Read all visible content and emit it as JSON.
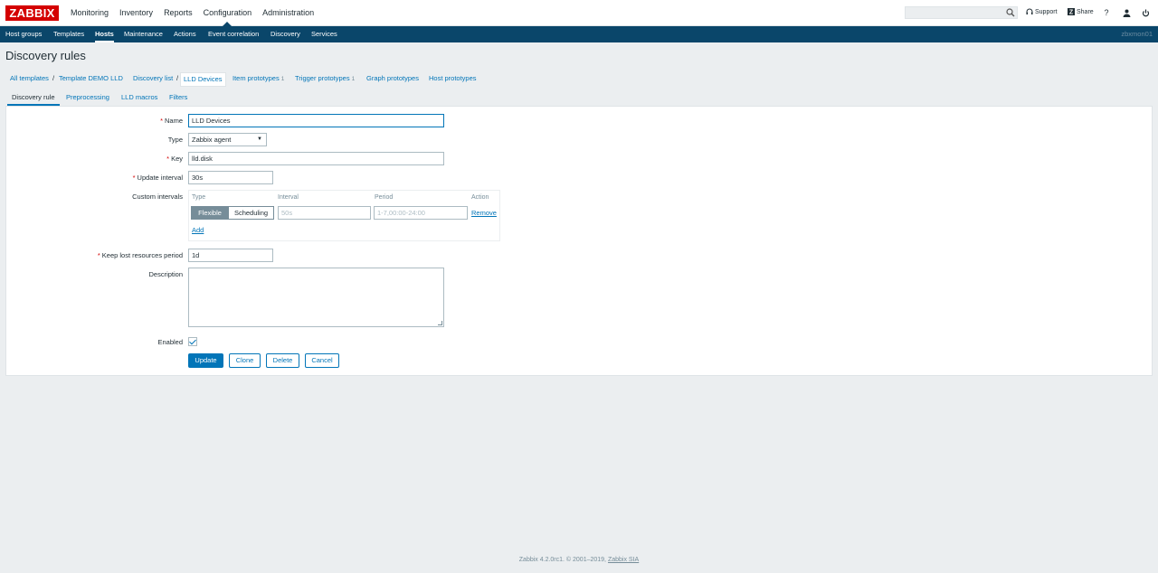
{
  "app": {
    "logo": "ZABBIX"
  },
  "main_menu": [
    "Monitoring",
    "Inventory",
    "Reports",
    "Configuration",
    "Administration"
  ],
  "top_right": {
    "search_placeholder": "",
    "support": "Support",
    "share": "Share",
    "help": "?"
  },
  "sub_menu": [
    "Host groups",
    "Templates",
    "Hosts",
    "Maintenance",
    "Actions",
    "Event correlation",
    "Discovery",
    "Services"
  ],
  "user": "zbxmon01",
  "page": {
    "title": "Discovery rules"
  },
  "breadcrumbs": {
    "all_templates": "All templates",
    "sep": "/",
    "template": "Template DEMO LLD",
    "discovery_list": "Discovery list",
    "current": "LLD Devices",
    "item_prototypes": "Item prototypes",
    "item_prototypes_count": "1",
    "trigger_prototypes": "Trigger prototypes",
    "trigger_prototypes_count": "1",
    "graph_prototypes": "Graph prototypes",
    "host_prototypes": "Host prototypes"
  },
  "tabs": [
    "Discovery rule",
    "Preprocessing",
    "LLD macros",
    "Filters"
  ],
  "form": {
    "required_mark": "*",
    "name_label": "Name",
    "name_value": "LLD Devices",
    "type_label": "Type",
    "type_value": "Zabbix agent",
    "type_arrow": "▼",
    "key_label": "Key",
    "key_value": "lld.disk",
    "update_interval_label": "Update interval",
    "update_interval_value": "30s",
    "custom_intervals_label": "Custom intervals",
    "ci_headers": {
      "type": "Type",
      "interval": "Interval",
      "period": "Period",
      "action": "Action"
    },
    "ci_flexible": "Flexible",
    "ci_scheduling": "Scheduling",
    "ci_interval_placeholder": "50s",
    "ci_period_placeholder": "1-7,00:00-24:00",
    "ci_remove": "Remove",
    "ci_add": "Add",
    "keep_lost_label": "Keep lost resources period",
    "keep_lost_value": "1d",
    "description_label": "Description",
    "enabled_label": "Enabled"
  },
  "buttons": {
    "update": "Update",
    "clone": "Clone",
    "delete": "Delete",
    "cancel": "Cancel"
  },
  "footer": {
    "text": "Zabbix 4.2.0rc1. © 2001–2019,",
    "link": "Zabbix SIA"
  },
  "colors": {
    "brand": "#d40000",
    "nav": "#0a466a",
    "link": "#0275b8",
    "bg": "#ebeef0"
  }
}
